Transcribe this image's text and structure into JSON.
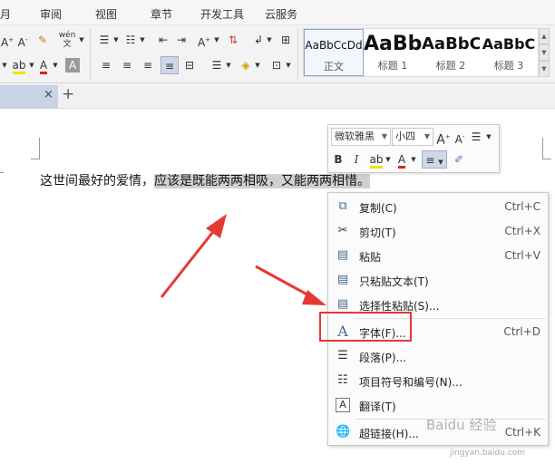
{
  "menubar": [
    "月",
    "审阅",
    "视图",
    "章节",
    "开发工具",
    "云服务"
  ],
  "styles": [
    {
      "preview": "AaBbCcDd",
      "name": "正文"
    },
    {
      "preview": "AaBb",
      "name": "标题 1"
    },
    {
      "preview": "AaBbC",
      "name": "标题 2"
    },
    {
      "preview": "AaBbC",
      "name": "标题 3"
    }
  ],
  "tabbar": {
    "close": "×",
    "add": "+"
  },
  "document": {
    "text_plain": "这世间最好的爱情，",
    "text_selected": "应该是既能两两相吸，又能两两相惜。"
  },
  "mini_toolbar": {
    "font_name": "微软雅黑",
    "font_size": "小四",
    "bold": "B",
    "italic": "I"
  },
  "context_menu": [
    {
      "label": "复制(C)",
      "shortcut": "Ctrl+C",
      "icon": "copy-icon"
    },
    {
      "label": "剪切(T)",
      "shortcut": "Ctrl+X",
      "icon": "scissors-icon"
    },
    {
      "label": "粘贴",
      "shortcut": "Ctrl+V",
      "icon": "paste-icon"
    },
    {
      "label": "只粘贴文本(T)",
      "shortcut": "",
      "icon": "paste-text-icon"
    },
    {
      "label": "选择性粘贴(S)...",
      "shortcut": "",
      "icon": "paste-special-icon"
    },
    {
      "label": "字体(F)...",
      "shortcut": "Ctrl+D",
      "icon": "font-icon"
    },
    {
      "label": "段落(P)...",
      "shortcut": "",
      "icon": "paragraph-icon"
    },
    {
      "label": "项目符号和编号(N)...",
      "shortcut": "",
      "icon": "bullet-list-icon"
    },
    {
      "label": "翻译(T)",
      "shortcut": "",
      "icon": "translate-icon"
    },
    {
      "label": "超链接(H)...",
      "shortcut": "Ctrl+K",
      "icon": "hyperlink-icon"
    }
  ],
  "watermark": {
    "main": "Baidu 经验",
    "sub": "jingyan.baidu.com"
  },
  "colors": {
    "highlight_box": "#e53935",
    "arrow": "#e53935",
    "selection": "#d0d0d0",
    "icon_blue": "#4a6890"
  }
}
